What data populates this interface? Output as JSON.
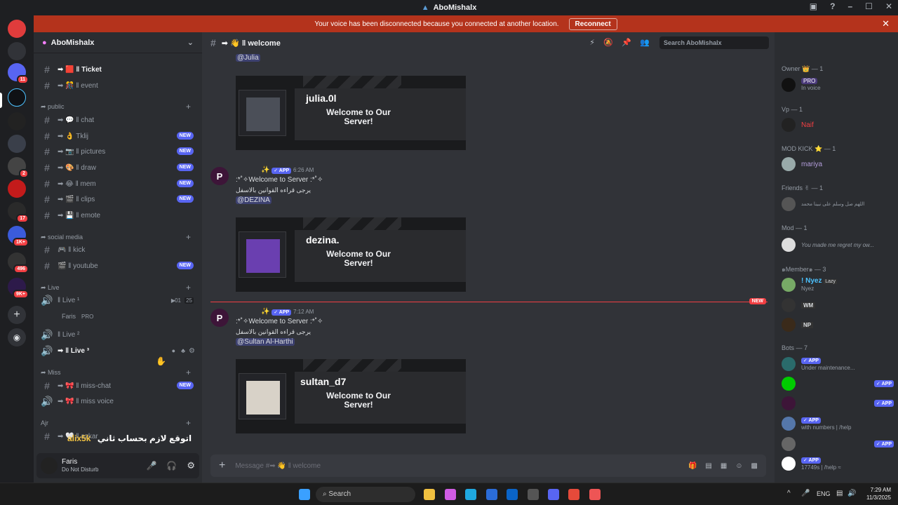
{
  "window": {
    "title": "AboMishalx"
  },
  "banner": {
    "text": "Your voice has been disconnected because you connected at another location.",
    "button": "Reconnect"
  },
  "guild_badges": {
    "dm": "11",
    "g1": "2",
    "g2": "17",
    "g3": "1K+",
    "g4": "496",
    "g5": "9K+"
  },
  "server": {
    "name": "AboMishalx"
  },
  "channels": {
    "ticket": "➡ 🟥 ‖ Ticket",
    "event": "➡ 🎊 ‖ event",
    "cat_public": "➦ public",
    "chat": "➡ 💬 ‖ chat",
    "tklij": "➡ 👌 Tklij",
    "pictures": "➡ 📷 ‖ pictures",
    "draw": "➡ 🎨 ‖ draw",
    "mem": "➡ 😂 ‖ mem",
    "clips": "➡ 🎬 ‖ clips",
    "emote": "➡ 💾 ‖ emote",
    "cat_social": "➦ social media",
    "kick": "🎮 ‖ kick",
    "youtube": "🎬 ‖ youtube",
    "cat_live": "➦ Live",
    "live1": "‖ Live ¹",
    "live1_count": "01",
    "live1_max": "25",
    "voice_user": "Faris",
    "voice_user_tag": "PRO",
    "live2": "‖ Live ²",
    "live3": "➡ ‖ Live ³",
    "cat_miss": "➦ Miss",
    "miss_chat": "➡ 🎀 ‖ miss-chat",
    "miss_voice": "➡ 🎀 ‖ miss voice",
    "cat_ajr": "Ajr",
    "azkar": "➡ 🤍 ‖ azkar",
    "new": "NEW"
  },
  "user": {
    "name": "Faris",
    "status": "Do Not Disturb"
  },
  "main": {
    "channel": "➡ 👋 ‖ welcome",
    "search_placeholder": "Search AboMishalx",
    "mention1": "@Julia",
    "card1_user": "julia.0l",
    "welcome_card": "Welcome to Our Server!",
    "msg_time1": "6:26 AM",
    "msg_time2": "7:12 AM",
    "app_tag": "✓ APP",
    "welcome_line": ":*˚✧Welcome to Server :*˚✧",
    "rules_line": "يرجى قراءه القوانين بالاسفل",
    "mention2": "@DEZINA",
    "card2_user": "dezina.",
    "mention3": "@Sultan Al-Harthi",
    "card3_user": "sultan_d7",
    "new_divider": "NEW",
    "composer_placeholder": "Message #➡ 👋 ‖ welcome"
  },
  "overlay": {
    "latin": "alix5k",
    "arabic": "اتوقع لازم بحساب ثاني"
  },
  "members": {
    "owner": "Owner 👑 — 1",
    "owner_tag": "PRO",
    "owner_status": "In voice",
    "vp": "Vp — 1",
    "vp_name": "Naif",
    "modkick": "MOD KICK ⭐ — 1",
    "modkick_name": "mariya",
    "friends": "Friends ✌ — 1",
    "friends_status": "اللهم صل وسلم على نبينا محمد",
    "mod": "Mod — 1",
    "mod_status": "You made me regret my ow...",
    "member": "๑Member๑ — 3",
    "m1": "! Nyez",
    "m1_tag": "Lazy",
    "m1_status": "Nyez",
    "m2_tag": "WM",
    "m3_tag": "NP",
    "bots": "Bots — 7",
    "bot1_status": "Under maintenance...",
    "bot3_status": "with numbers | /help",
    "bot5_status": "17749s | /help ≈"
  },
  "taskbar": {
    "search": "Search",
    "lang": "ENG",
    "time": "7:29 AM",
    "date": "11/3/2025"
  }
}
